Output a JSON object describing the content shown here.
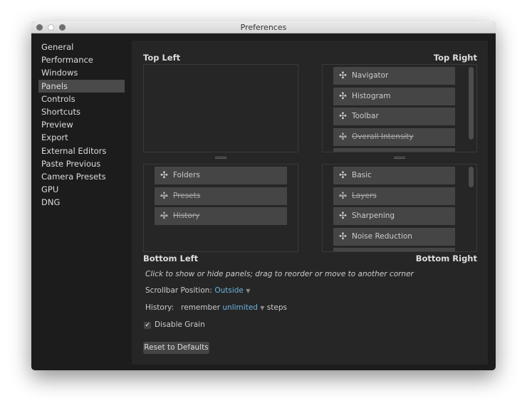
{
  "window": {
    "title": "Preferences"
  },
  "sidebar": {
    "items": [
      {
        "label": "General"
      },
      {
        "label": "Performance"
      },
      {
        "label": "Windows"
      },
      {
        "label": "Panels",
        "selected": true
      },
      {
        "label": "Controls"
      },
      {
        "label": "Shortcuts"
      },
      {
        "label": "Preview"
      },
      {
        "label": "Export"
      },
      {
        "label": "External Editors"
      },
      {
        "label": "Paste Previous"
      },
      {
        "label": "Camera Presets"
      },
      {
        "label": "GPU"
      },
      {
        "label": "DNG"
      }
    ]
  },
  "panels": {
    "top_left": {
      "label": "Top Left",
      "items": []
    },
    "top_right": {
      "label": "Top Right",
      "items": [
        {
          "label": "Navigator",
          "hidden": false
        },
        {
          "label": "Histogram",
          "hidden": false
        },
        {
          "label": "Toolbar",
          "hidden": false
        },
        {
          "label": "Overall Intensity",
          "hidden": true
        }
      ]
    },
    "bottom_left": {
      "label": "Bottom Left",
      "items": [
        {
          "label": "Folders",
          "hidden": false
        },
        {
          "label": "Presets",
          "hidden": true
        },
        {
          "label": "History",
          "hidden": true
        }
      ]
    },
    "bottom_right": {
      "label": "Bottom Right",
      "items": [
        {
          "label": "Basic",
          "hidden": false
        },
        {
          "label": "Layers",
          "hidden": true
        },
        {
          "label": "Sharpening",
          "hidden": false
        },
        {
          "label": "Noise Reduction",
          "hidden": false
        }
      ]
    }
  },
  "hint": "Click to show or hide panels; drag to reorder or move to another corner",
  "scrollbar": {
    "label": "Scrollbar Position:",
    "value": "Outside"
  },
  "history": {
    "label": "History:",
    "prefix": "remember",
    "value": "unlimited",
    "suffix": "steps"
  },
  "grain": {
    "label": "Disable Grain",
    "checked": true,
    "mark": "✓"
  },
  "reset_label": "Reset to Defaults",
  "icons": {
    "move": "✣",
    "caret": "▼"
  }
}
